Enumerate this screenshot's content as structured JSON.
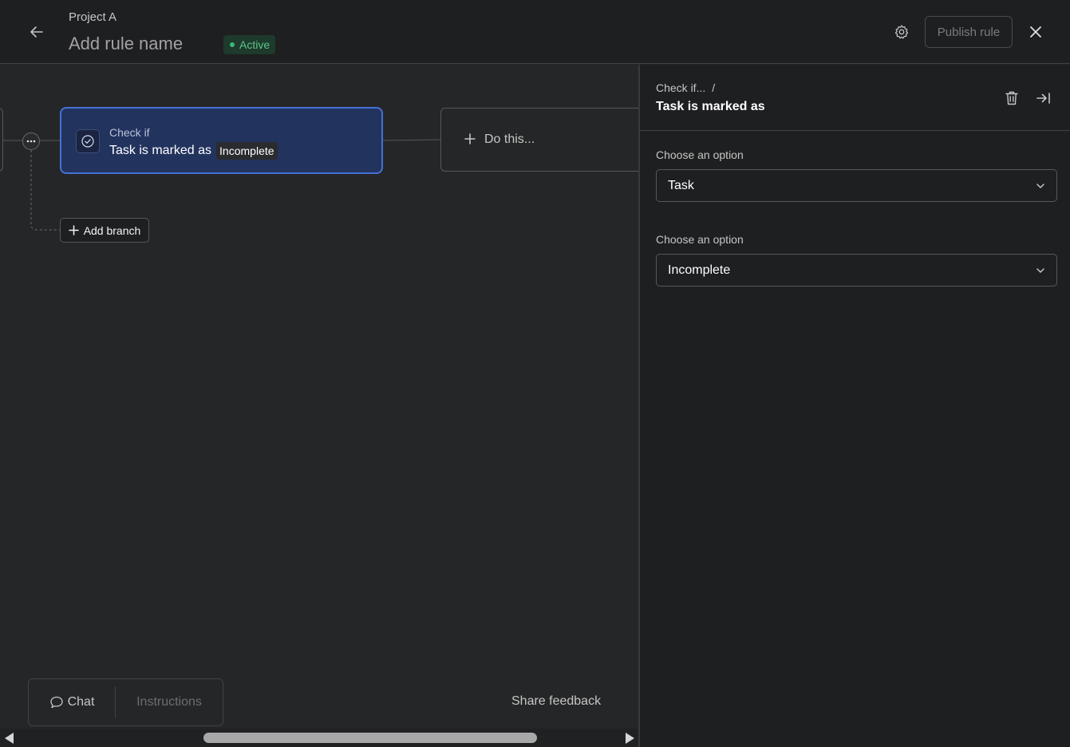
{
  "header": {
    "project": "Project A",
    "rule_name": "Add rule name",
    "status": "Active",
    "publish_label": "Publish rule"
  },
  "canvas": {
    "trigger_card": {
      "label": "Check if",
      "main_text": "Task is marked as",
      "value_pill": "Incomplete"
    },
    "action_card": {
      "label": "Do this..."
    },
    "add_branch_label": "Add branch"
  },
  "bottom": {
    "chat_label": "Chat",
    "instructions_label": "Instructions",
    "share_feedback": "Share feedback"
  },
  "panel": {
    "breadcrumb": "Check if...",
    "breadcrumb_separator": "/",
    "title": "Task is marked as",
    "fields": [
      {
        "label": "Choose an option",
        "value": "Task"
      },
      {
        "label": "Choose an option",
        "value": "Incomplete"
      }
    ]
  },
  "colors": {
    "accent_blue": "#4571d6",
    "status_green": "#3fb877",
    "background": "#252628"
  }
}
